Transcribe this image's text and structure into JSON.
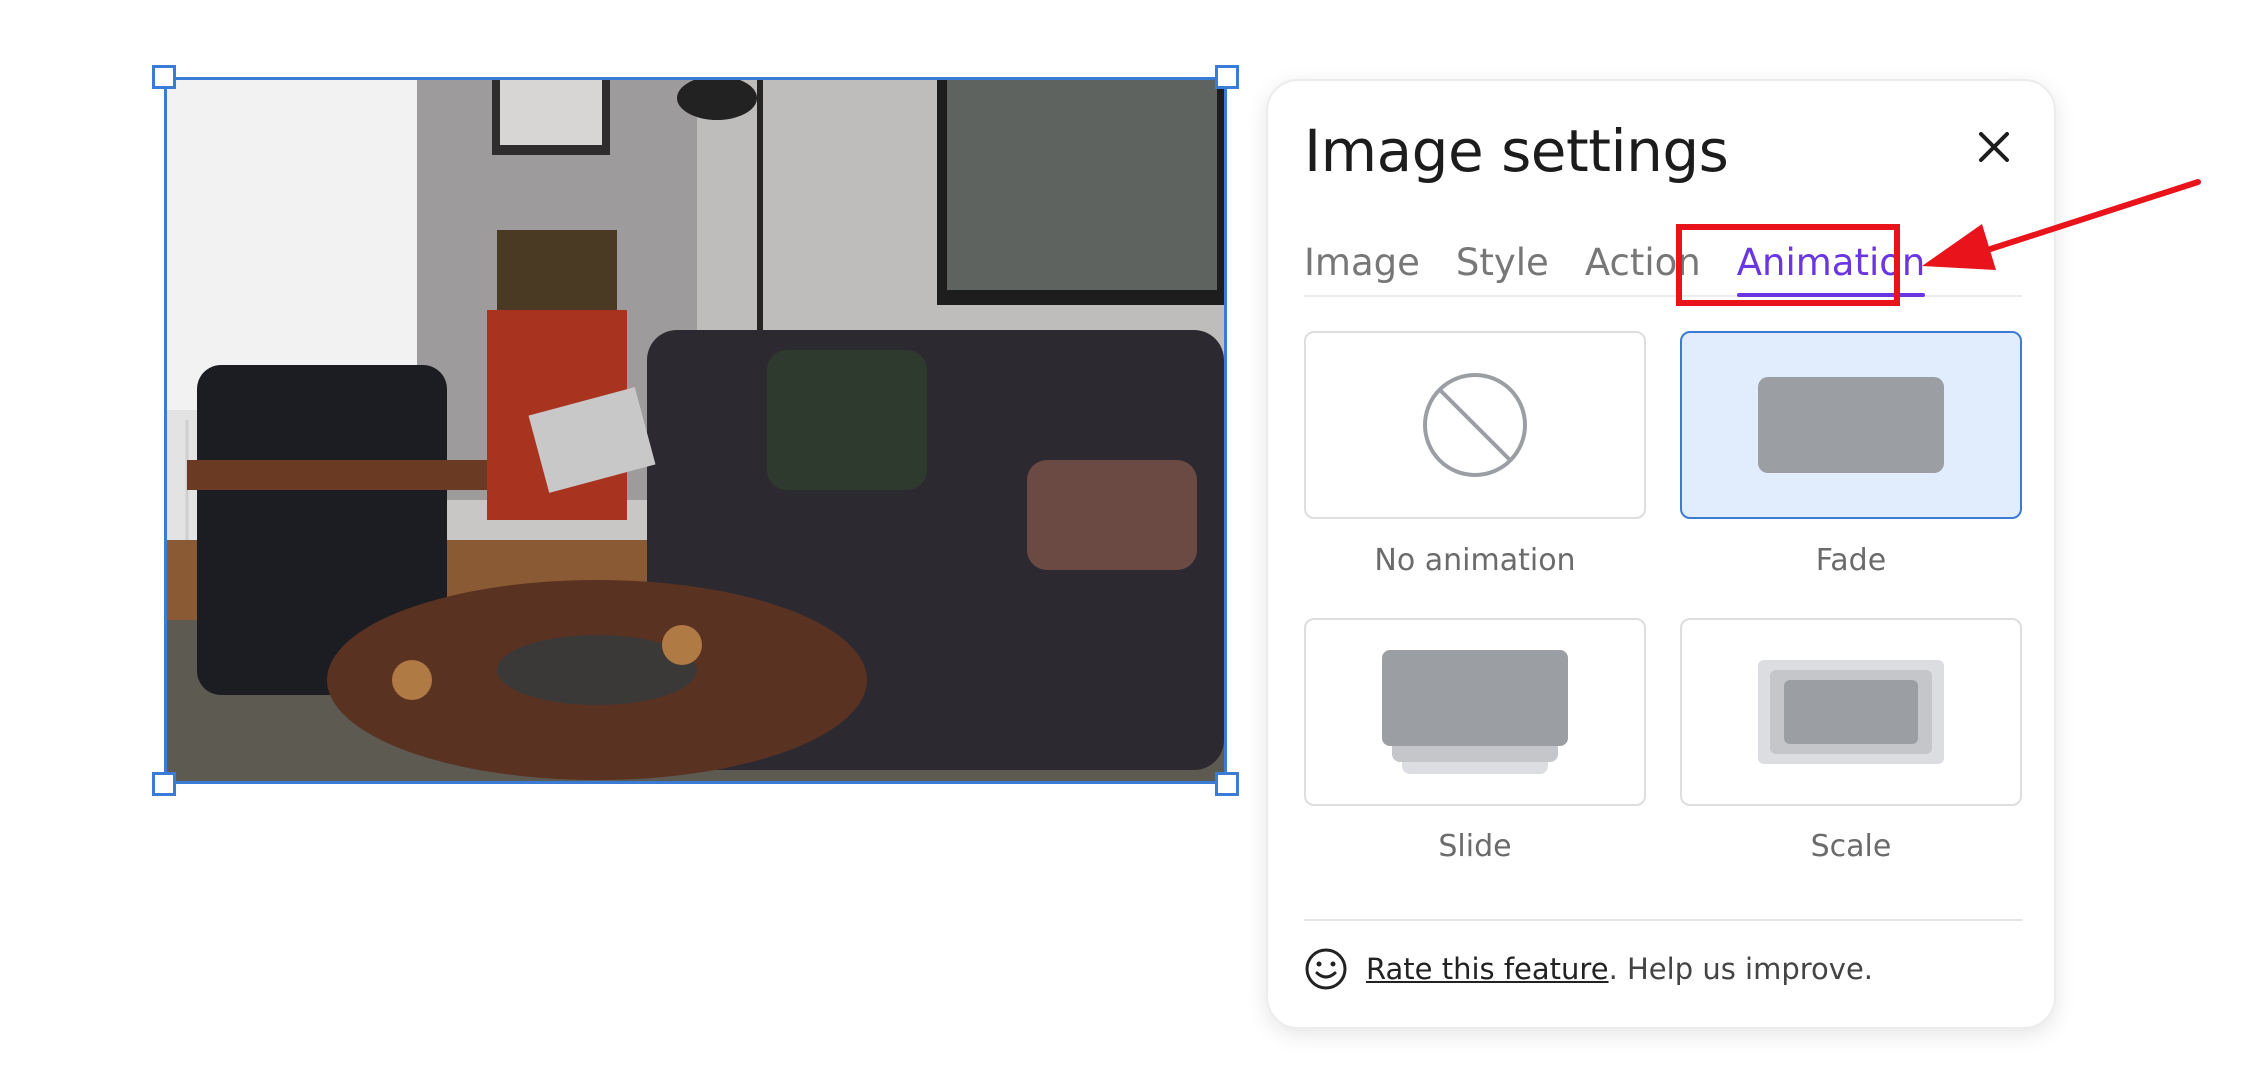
{
  "panel": {
    "title": "Image settings",
    "tabs": [
      {
        "label": "Image",
        "active": false
      },
      {
        "label": "Style",
        "active": false
      },
      {
        "label": "Action",
        "active": false
      },
      {
        "label": "Animation",
        "active": true
      }
    ],
    "animations": [
      {
        "label": "No animation",
        "icon": "no-animation-icon",
        "selected": false
      },
      {
        "label": "Fade",
        "icon": "fade-icon",
        "selected": true
      },
      {
        "label": "Slide",
        "icon": "slide-icon",
        "selected": false
      },
      {
        "label": "Scale",
        "icon": "scale-icon",
        "selected": false
      }
    ],
    "footer": {
      "link_text": "Rate this feature",
      "suffix_text": ". Help us improve."
    }
  },
  "colors": {
    "accent": "#6a36e0",
    "selection": "#3a7bd5",
    "selected_card_bg": "#e1ecfd",
    "annotation": "#e8131b"
  }
}
